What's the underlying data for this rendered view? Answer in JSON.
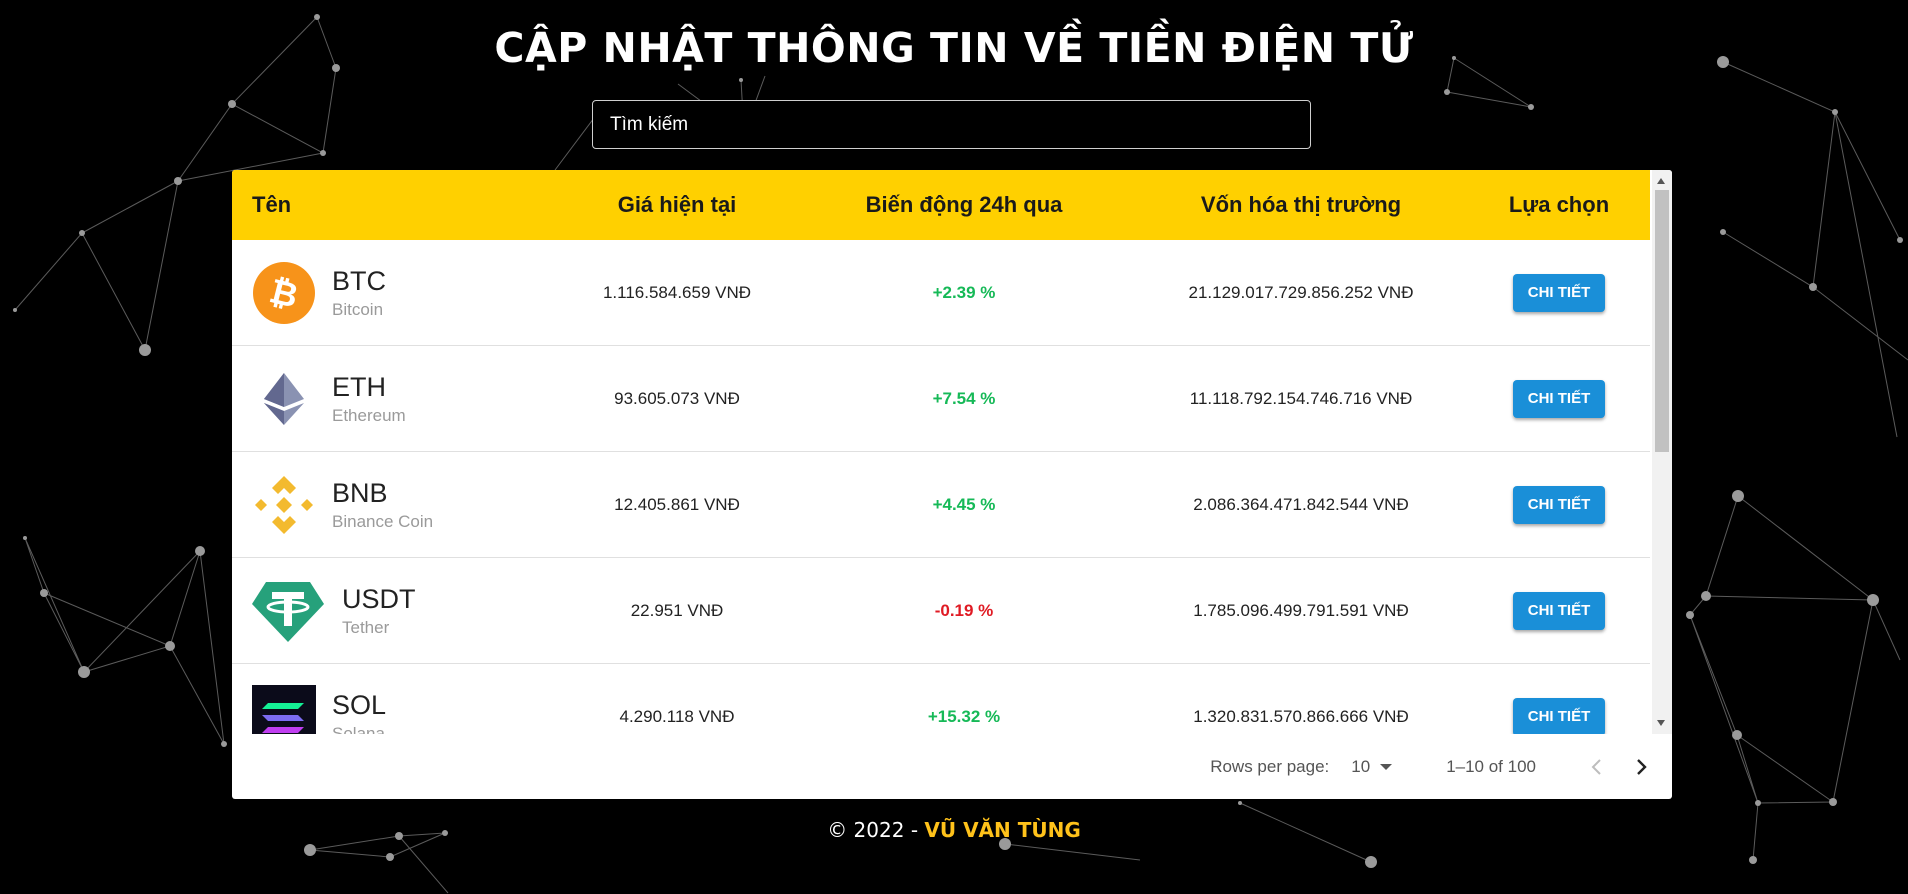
{
  "page_title": "CẬP NHẬT THÔNG TIN VỀ TIỀN ĐIỆN TỬ",
  "search": {
    "placeholder": "Tìm kiếm"
  },
  "table": {
    "headers": {
      "name": "Tên",
      "price": "Giá hiện tại",
      "change": "Biến động 24h qua",
      "market_cap": "Vốn hóa thị trường",
      "action": "Lựa chọn"
    },
    "rows": [
      {
        "symbol": "BTC",
        "name": "Bitcoin",
        "price": "1.116.584.659 VNĐ",
        "change": "+2.39 %",
        "market_cap": "21.129.017.729.856.252 VNĐ",
        "button": "CHI TIẾT",
        "icon": "bitcoin-icon"
      },
      {
        "symbol": "ETH",
        "name": "Ethereum",
        "price": "93.605.073 VNĐ",
        "change": "+7.54 %",
        "market_cap": "11.118.792.154.746.716 VNĐ",
        "button": "CHI TIẾT",
        "icon": "ethereum-icon"
      },
      {
        "symbol": "BNB",
        "name": "Binance Coin",
        "price": "12.405.861 VNĐ",
        "change": "+4.45 %",
        "market_cap": "2.086.364.471.842.544 VNĐ",
        "button": "CHI TIẾT",
        "icon": "binance-coin-icon"
      },
      {
        "symbol": "USDT",
        "name": "Tether",
        "price": "22.951 VNĐ",
        "change": "-0.19 %",
        "market_cap": "1.785.096.499.791.591 VNĐ",
        "button": "CHI TIẾT",
        "icon": "tether-icon"
      },
      {
        "symbol": "SOL",
        "name": "Solana",
        "price": "4.290.118 VNĐ",
        "change": "+15.32 %",
        "market_cap": "1.320.831.570.866.666 VNĐ",
        "button": "CHI TIẾT",
        "icon": "solana-icon"
      }
    ]
  },
  "pagination": {
    "rows_per_page_label": "Rows per page:",
    "rows_per_page_value": "10",
    "range_label": "1–10 of 100"
  },
  "footer": {
    "copyright_prefix": "© 2022 - ",
    "author": "VŨ VĂN TÙNG"
  },
  "colors": {
    "header_bg": "#ffd000",
    "positive": "#16b957",
    "negative": "#e01b24",
    "button": "#1a8fd8",
    "author": "#ffc21a"
  }
}
